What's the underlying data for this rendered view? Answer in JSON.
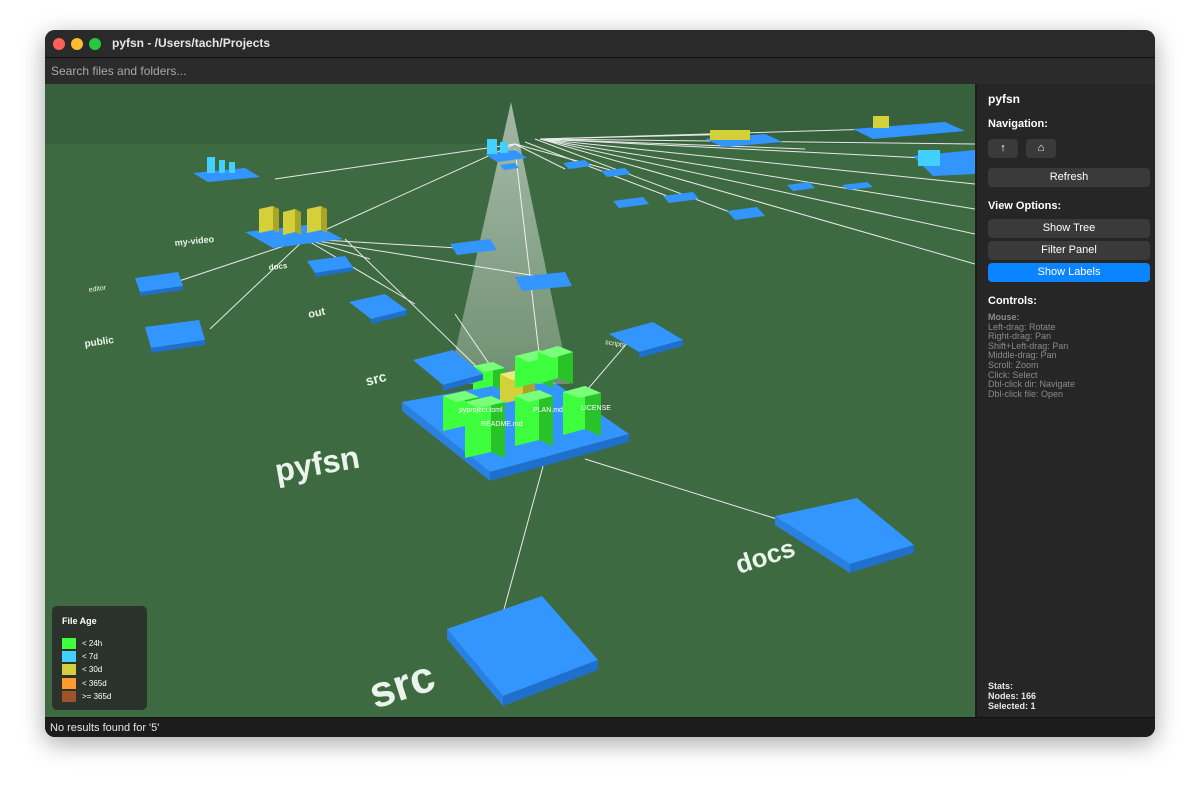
{
  "window": {
    "title": "pyfsn - /Users/tach/Projects"
  },
  "search": {
    "placeholder": "Search files and folders..."
  },
  "scene": {
    "root_label": "pyfsn",
    "near_labels": {
      "src": "src",
      "docs": "docs"
    },
    "dir_labels": {
      "src": "src",
      "out": "out",
      "docs": "docs",
      "public": "public",
      "editor": "editor",
      "scripts": "scripts",
      "my_video": "my-video"
    },
    "file_labels": {
      "readme": "README.md",
      "plan": "PLAN.md",
      "license": "LICENSE",
      "pyproject": "pyproject.toml"
    },
    "colors": {
      "ground": "#3e6a42",
      "folder": "#3396ff",
      "fresh": "#3dff3d",
      "week": "#42d0ff",
      "month": "#d4d03a",
      "year": "#ff9a2e",
      "old": "#a0522d"
    }
  },
  "legend": {
    "title": "File Age",
    "items": [
      {
        "label": "< 24h",
        "color": "#3dff3d"
      },
      {
        "label": "< 7d",
        "color": "#42d0ff"
      },
      {
        "label": "< 30d",
        "color": "#d4d03a"
      },
      {
        "label": "< 365d",
        "color": "#ff9a2e"
      },
      {
        "label": ">= 365d",
        "color": "#a0522d"
      }
    ]
  },
  "panel": {
    "title": "pyfsn",
    "navigation_heading": "Navigation:",
    "nav_up": "↑",
    "nav_home": "⌂",
    "refresh": "Refresh",
    "view_options_heading": "View Options:",
    "show_tree": "Show Tree",
    "filter_panel": "Filter Panel",
    "show_labels": "Show Labels",
    "controls_heading": "Controls:",
    "controls": [
      "Mouse:",
      "Left-drag: Rotate",
      "Right-drag: Pan",
      "Shift+Left-drag: Pan",
      "Middle-drag: Pan",
      "Scroll: Zoom",
      "Click: Select",
      "Dbl-click dir: Navigate",
      "Dbl-click file: Open"
    ],
    "stats_heading": "Stats:",
    "nodes": "Nodes: 166",
    "selected": "Selected: 1"
  },
  "status": {
    "text": "No results found for '5'"
  }
}
